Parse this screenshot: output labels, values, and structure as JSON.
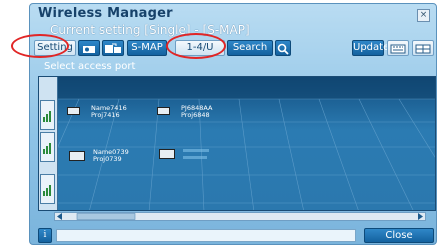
{
  "window": {
    "title": "Wireless Manager",
    "close_glyph": "×",
    "current_setting": "Current setting [Single] - [S-MAP]"
  },
  "toolbar": {
    "setting_label": "Setting",
    "mode_label": "S-MAP",
    "range_label": "1-4/U",
    "search_label": "Search",
    "update_label": "Update"
  },
  "map": {
    "heading": "Select access port",
    "access_points": [
      {
        "name": "Name7416",
        "proj": "Proj7416"
      },
      {
        "name": "PJ6848AA",
        "proj": "Proj6848"
      },
      {
        "name": "Name0739",
        "proj": "Proj0739"
      },
      {
        "name": "",
        "proj": ""
      }
    ]
  },
  "statusbar": {
    "info_glyph": "i",
    "close_label": "Close"
  },
  "colors": {
    "accent": "#14629f",
    "window": "#8ec3e6",
    "map": "#2b78ae",
    "highlight": "#e12626"
  }
}
